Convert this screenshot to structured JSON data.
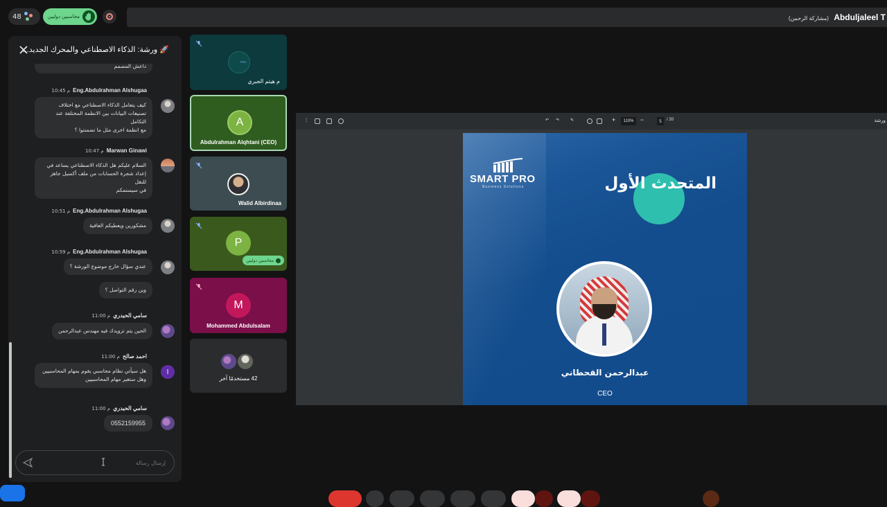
{
  "topbar": {
    "participant_count": "48",
    "hand_raise_label": "محاسبين دوليين",
    "presenter_name": "Abduljaleel T",
    "presenter_suffix": "(مشاركة الرحمن)"
  },
  "chat": {
    "title": "ورشة: الذكاء الاصطناعي والمحرك الجديد...",
    "title_icon": "rocket-icon",
    "partial_top_text": "داعش المصمم",
    "messages": [
      {
        "name": "Eng.Abdulrahman Alshugaa",
        "time": "10:45 م",
        "lines": [
          "كيف يتعامل الذكاء الاصطناعي مع اختلاف",
          "تصنيفات البيانات بين الانظمة المختلفة عند التكامل",
          "مع انظمة اخرى مثل ما تضمنتوا ؟"
        ]
      },
      {
        "name": "Marwan Ginawi",
        "time": "10:47 م",
        "lines": [
          "السلام عليكم هل الذكاء الاصطناعي يساعد في",
          "إعداد شجرة الحسابات من ملف أكسيل جاهز للنقل",
          "في سيستمكم"
        ]
      },
      {
        "name": "Eng.Abdulrahman Alshugaa",
        "time": "10:51 م",
        "lines": [
          "مشكورين ويعطيكم العافية"
        ]
      },
      {
        "name": "Eng.Abdulrahman Alshugaa",
        "time": "10:59 م",
        "lines": [
          "عندي سؤال خارج موضوع الورشة ؟"
        ],
        "extra": "وين رقم التواصل ؟"
      },
      {
        "name": "سامي الحيدري",
        "time": "11:00 م",
        "lines": [
          "الحين يتم تزويدك فيه مهندس عبدالرحمن"
        ]
      },
      {
        "name": "احمد صالح",
        "time": "11:00 م",
        "avatar_letter": "I",
        "lines": [
          "هل سيأتي نظام محاسبي يقوم بمهام المحاسبيين",
          "وهل ستغير مهام المحاسبيين"
        ]
      },
      {
        "name": "سامي الحيدري",
        "time": "11:00 م",
        "lines": [
          "0552159955"
        ]
      }
    ],
    "input_placeholder": "إرسال رسالة"
  },
  "tiles": [
    {
      "name": "م هيثم الجبري",
      "logo_text": "PRO"
    },
    {
      "name": "Abdulrahman Alqhtani (CEO)",
      "letter": "A"
    },
    {
      "name": "Walid Albirdinaa"
    },
    {
      "name": "",
      "letter": "P",
      "badge": "محاسبين دوليين"
    },
    {
      "name": "Mohammed Abdulsalam",
      "letter": "M"
    },
    {
      "name": "42 مستخدمًا آخر"
    }
  ],
  "presentation": {
    "zoom": "110%",
    "page_current": "5",
    "page_total": "/ 20",
    "doc_title": "ورشة",
    "slide": {
      "brand": "SMART PRO",
      "brand_sub": "Business Solutions",
      "heading": "المتحدث الأول",
      "speaker_name": "عبدالرحمن القحطاني",
      "speaker_role": "CEO"
    }
  },
  "colors": {
    "background": "#131314",
    "panel": "#1e1f20",
    "hand_green": "#6dd58c",
    "slide_blue": "#134c8c",
    "teal_accent": "#2fbfae",
    "leave_red": "#dc362e"
  }
}
